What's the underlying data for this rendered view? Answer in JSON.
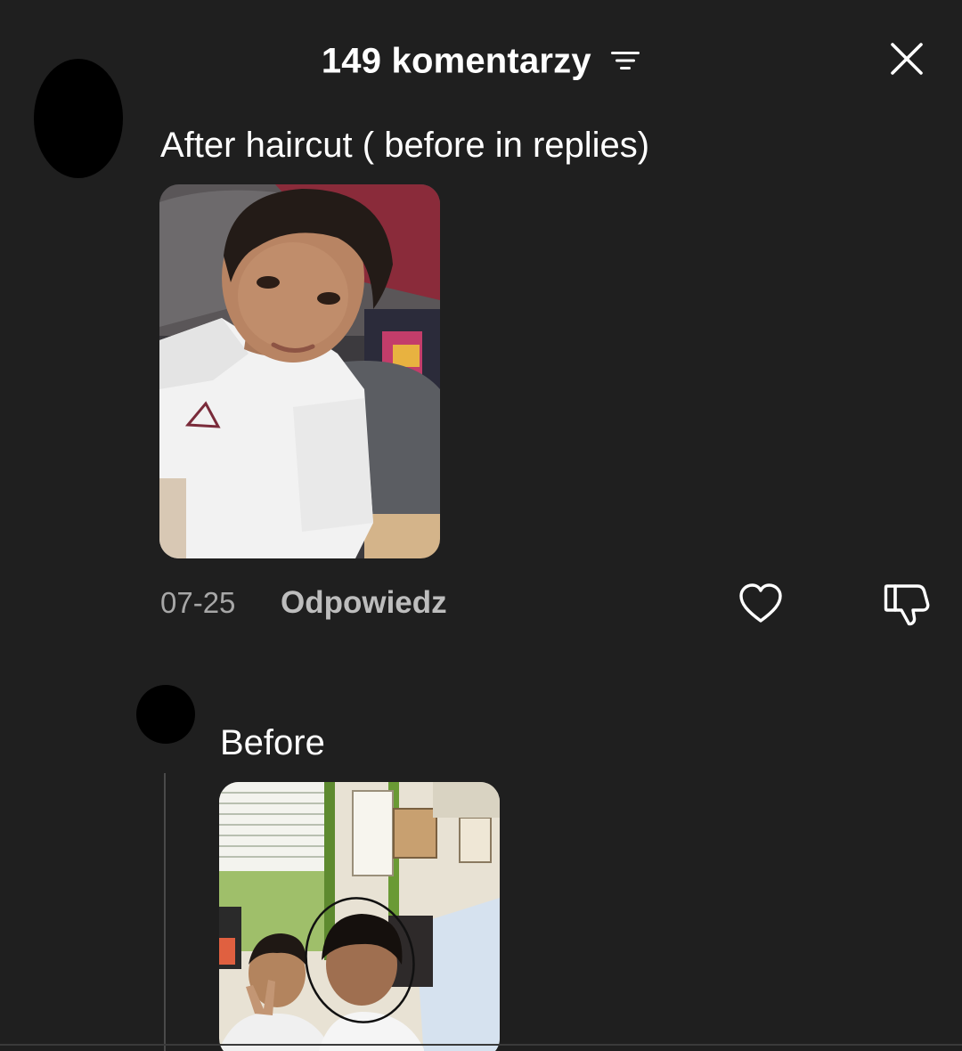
{
  "header": {
    "title": "149 komentarzy",
    "sort_icon": "sort-lines-icon",
    "close_icon": "close-x-icon"
  },
  "comment": {
    "text": "After haircut ( before in replies)",
    "date": "07-25",
    "reply_label": "Odpowiedz",
    "like_icon": "heart-outline-icon",
    "dislike_icon": "thumbs-down-outline-icon"
  },
  "reply": {
    "text": "Before"
  },
  "colors": {
    "background": "#1f1f1f",
    "text_primary": "#ffffff",
    "text_secondary": "#a7a7a7",
    "reply_button": "#bdbdbd"
  }
}
